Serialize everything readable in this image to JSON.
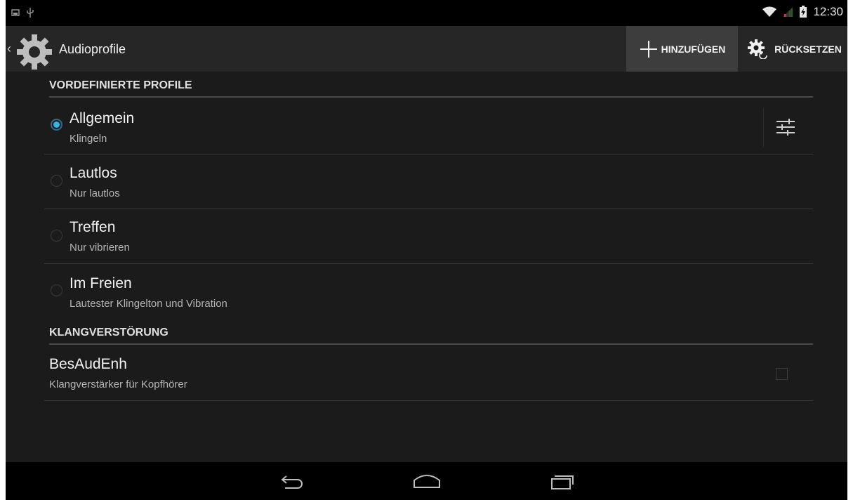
{
  "status_bar": {
    "time": "12:30",
    "left_icons": [
      "screenshot-icon",
      "usb-icon"
    ],
    "right_icons": [
      "wifi-icon",
      "signal-icon",
      "battery-icon"
    ]
  },
  "action_bar": {
    "title": "Audioprofile",
    "add_label": "HINZUFÜGEN",
    "reset_label": "RÜCKSETZEN"
  },
  "sections": {
    "predefined": {
      "header": "VORDEFINIERTE PROFILE",
      "profiles": [
        {
          "title": "Allgemein",
          "subtitle": "Klingeln",
          "selected": true
        },
        {
          "title": "Lautlos",
          "subtitle": "Nur lautlos",
          "selected": false
        },
        {
          "title": "Treffen",
          "subtitle": "Nur vibrieren",
          "selected": false
        },
        {
          "title": "Im Freien",
          "subtitle": "Lautester Klingelton und Vibration",
          "selected": false
        }
      ]
    },
    "enhancement": {
      "header": "KLANGVERSTÖRUNG",
      "item": {
        "title": "BesAudEnh",
        "subtitle": "Klangverstärker für Kopfhörer",
        "checked": false
      }
    }
  },
  "colors": {
    "accent": "#33b5e5",
    "background": "#1b1b1b",
    "action_bar": "#262626",
    "highlight_button": "#3d3d3d"
  }
}
